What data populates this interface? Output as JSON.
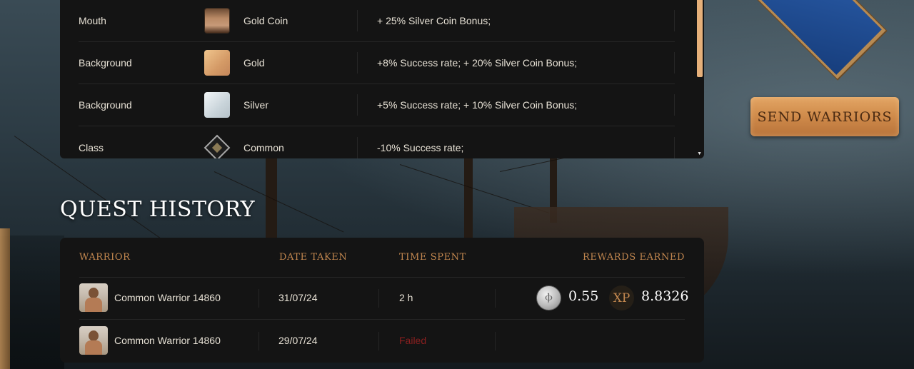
{
  "traits": [
    {
      "type": "Mouth",
      "swatch": "face",
      "name": "Gold Coin",
      "effect": "+ 25% Silver Coin Bonus;"
    },
    {
      "type": "Background",
      "swatch": "gold",
      "name": "Gold",
      "effect": "+8% Success rate; + 20% Silver Coin Bonus;"
    },
    {
      "type": "Background",
      "swatch": "silver",
      "name": "Silver",
      "effect": "+5% Success rate; + 10% Silver Coin Bonus;"
    },
    {
      "type": "Class",
      "swatch": "diamond",
      "name": "Common",
      "effect": "-10% Success rate;"
    }
  ],
  "send_button": "SEND WARRIORS",
  "quest_history": {
    "title": "QUEST HISTORY",
    "columns": {
      "warrior": "WARRIOR",
      "date_taken": "DATE TAKEN",
      "time_spent": "TIME SPENT",
      "rewards": "REWARDS EARNED"
    },
    "rows": [
      {
        "warrior": "Common Warrior 14860",
        "date": "31/07/24",
        "time": "2 h",
        "coin_reward": "0.55",
        "xp_label": "XP",
        "xp_reward": "8.8326"
      },
      {
        "warrior": "Common Warrior 14860",
        "date": "29/07/24",
        "time": "Failed"
      }
    ]
  },
  "colors": {
    "accent": "#c2874f",
    "button": "#cf8a4a",
    "failed": "#8a1f1f",
    "panel": "#141414"
  }
}
